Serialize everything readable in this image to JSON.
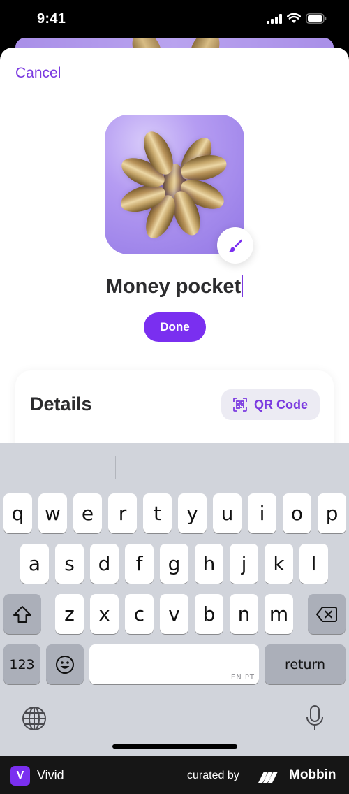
{
  "status_bar": {
    "time": "9:41",
    "icons": [
      "signal-icon",
      "wifi-icon",
      "battery-icon"
    ]
  },
  "header": {
    "cancel_label": "Cancel"
  },
  "pocket": {
    "name": "Money pocket",
    "image": "coins-illustration",
    "edit_icon": "paintbrush-icon"
  },
  "actions": {
    "done_label": "Done"
  },
  "details": {
    "title": "Details",
    "qr_label": "QR Code",
    "qr_icon": "qr-scan-icon"
  },
  "keyboard": {
    "row1": [
      "q",
      "w",
      "e",
      "r",
      "t",
      "y",
      "u",
      "i",
      "o",
      "p"
    ],
    "row2": [
      "a",
      "s",
      "d",
      "f",
      "g",
      "h",
      "j",
      "k",
      "l"
    ],
    "row3": [
      "z",
      "x",
      "c",
      "v",
      "b",
      "n",
      "m"
    ],
    "numbers_label": "123",
    "return_label": "return",
    "space_hint": "EN PT",
    "icons": [
      "shift-icon",
      "backspace-icon",
      "emoji-icon",
      "globe-icon",
      "microphone-icon"
    ]
  },
  "footer": {
    "app_initial": "V",
    "app_name": "Vivid",
    "curated_by": "curated by",
    "brand": "Mobbin"
  },
  "colors": {
    "accent": "#7a2ff0",
    "link": "#7b3ae0",
    "keyboard_bg": "#d1d4db",
    "footer_bg": "#161616"
  }
}
